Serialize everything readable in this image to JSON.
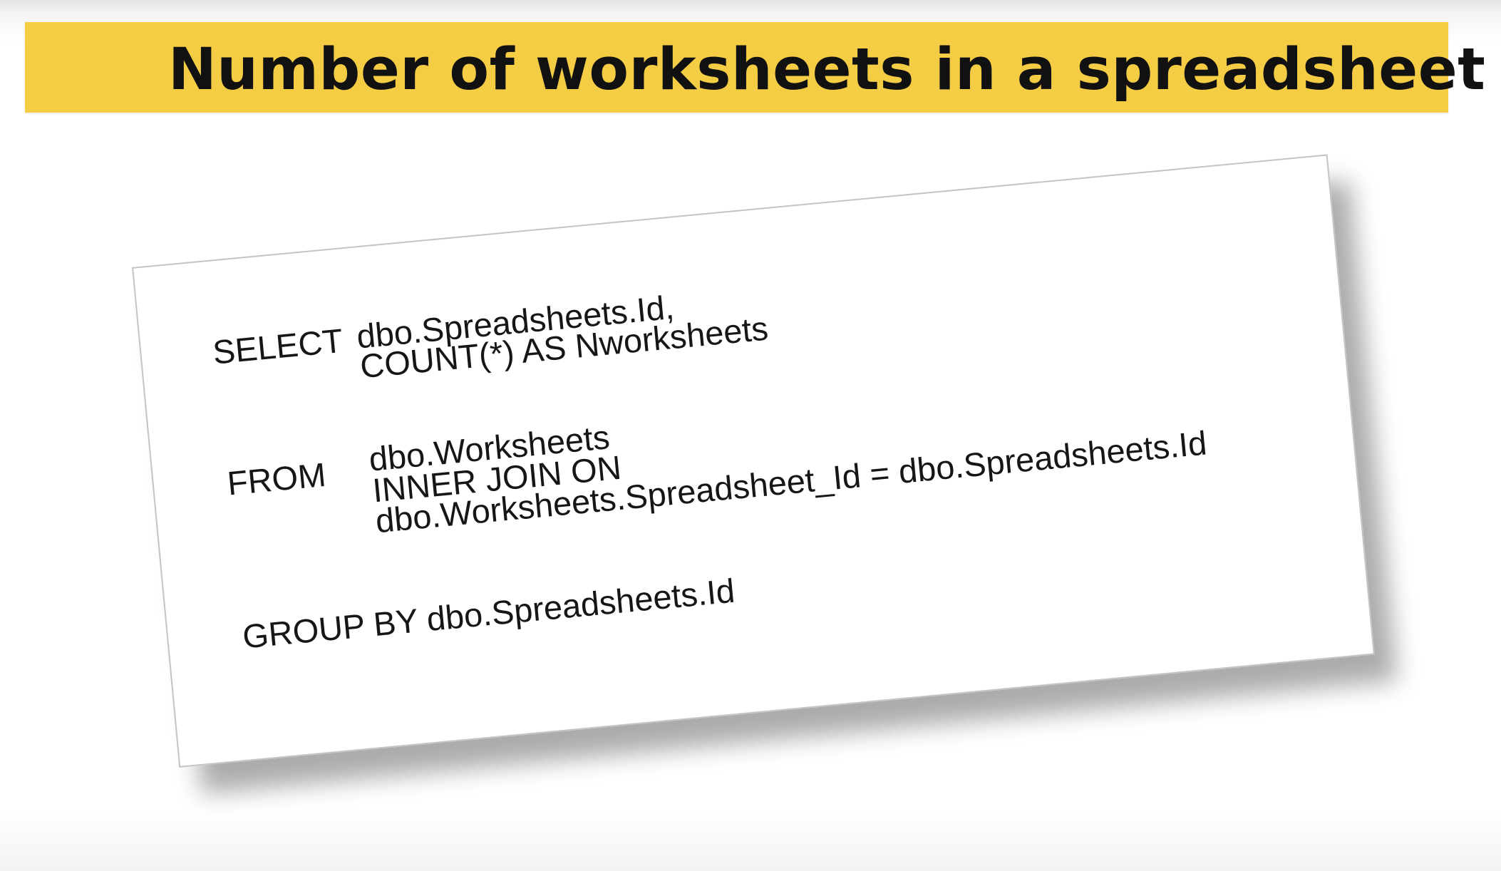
{
  "slide": {
    "title": "Number of worksheets in a spreadsheet"
  },
  "query": {
    "select_keyword": "SELECT",
    "select_line1": "dbo.Spreadsheets.Id,",
    "select_line2": "COUNT(*) AS Nworksheets",
    "from_keyword": "FROM",
    "from_line1": "dbo.Worksheets",
    "from_line2": "INNER JOIN ON",
    "from_line3": "dbo.Worksheets.Spreadsheet_Id = dbo.Spreadsheets.Id",
    "group_by_line": "GROUP BY dbo.Spreadsheets.Id"
  },
  "colors": {
    "title_band": "#f5cd45",
    "title_text": "#111111",
    "code_text": "#161616"
  }
}
